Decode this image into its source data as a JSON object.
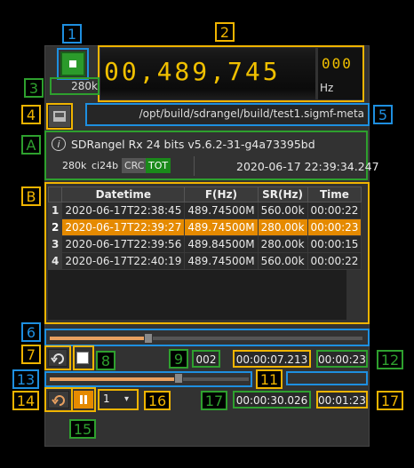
{
  "annotations": [
    "1",
    "2",
    "3",
    "4",
    "5",
    "A",
    "B",
    "6",
    "7",
    "8",
    "9",
    "10",
    "11",
    "12",
    "13",
    "14",
    "15",
    "16",
    "17"
  ],
  "colors": {
    "yellow": "#f0b400",
    "blue": "#1e8fe0",
    "green": "#2ea02e",
    "orange": "#e58a00"
  },
  "frequency": {
    "main": "00,489,745",
    "sub": "000",
    "unit": "Hz",
    "samplerate": "280k"
  },
  "file": {
    "path": "/opt/build/sdrangel/build/test1.sigmf-meta",
    "open_icon": "file-open-icon"
  },
  "info": {
    "description": "SDRangel Rx 24 bits v5.6.2-31-g4a73395bd",
    "rate": "280k",
    "format": "ci24b",
    "crc": "CRC",
    "tot": "TOT",
    "datetime": "2020-06-17 22:39:34.247"
  },
  "table": {
    "headers": [
      "Datetime",
      "F(Hz)",
      "SR(Hz)",
      "Time"
    ],
    "rows": [
      {
        "n": "1",
        "datetime": "2020-06-17T22:38:45",
        "f": "489.74500M",
        "sr": "560.00k",
        "time": "00:00:22"
      },
      {
        "n": "2",
        "datetime": "2020-06-17T22:39:27",
        "f": "489.74500M",
        "sr": "280.00k",
        "time": "00:00:23"
      },
      {
        "n": "3",
        "datetime": "2020-06-17T22:39:56",
        "f": "489.84500M",
        "sr": "280.00k",
        "time": "00:00:15"
      },
      {
        "n": "4",
        "datetime": "2020-06-17T22:40:19",
        "f": "489.74500M",
        "sr": "560.00k",
        "time": "00:00:22"
      }
    ]
  },
  "track": {
    "number": "002",
    "elapsed": "00:00:07.213",
    "duration": "00:00:23"
  },
  "record": {
    "elapsed": "00:00:30.026",
    "duration": "00:01:23",
    "speed": "1"
  }
}
